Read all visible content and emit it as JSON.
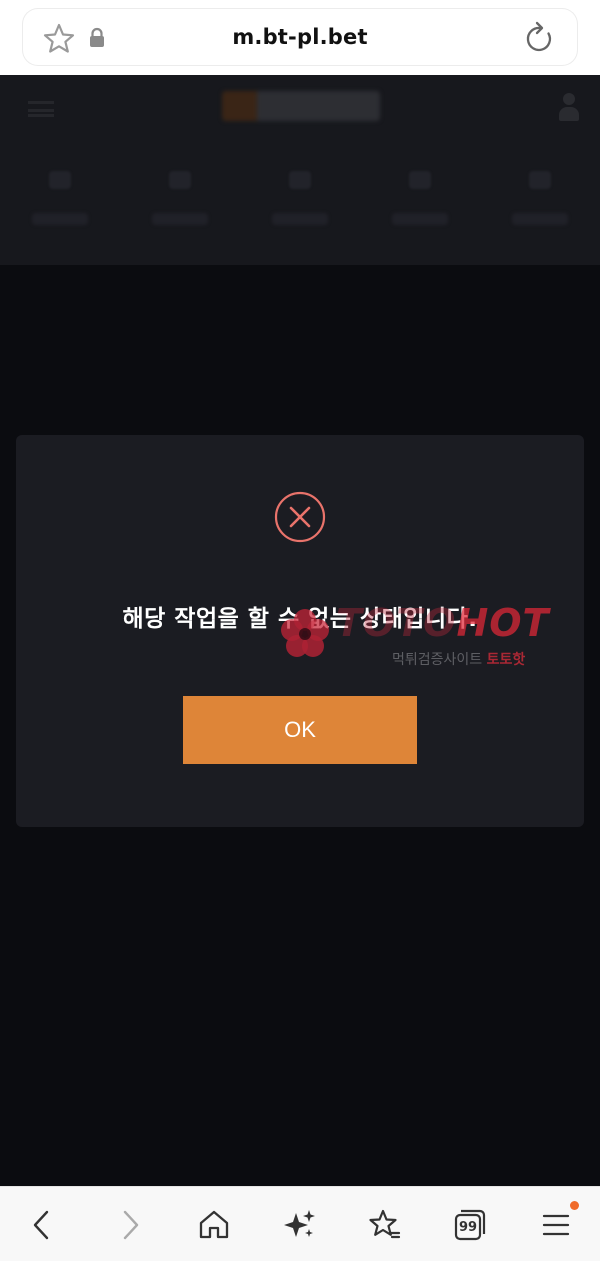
{
  "browser": {
    "url": "m.bt-pl.bet",
    "icons": [
      "star-icon",
      "lock-icon",
      "reload-icon"
    ]
  },
  "dialog": {
    "message": "해당 작업을 할 수 없는 상태입니다.",
    "ok_label": "OK",
    "icon": "error-x-icon",
    "colors": {
      "accent": "#de8538",
      "icon_ring": "#e9736b",
      "panel": "#1b1c22"
    }
  },
  "watermark": {
    "logo_part1": "TOTO",
    "logo_part2": "HOT",
    "sub_part1": "먹튀검증사이트 ",
    "sub_part2": "토토핫"
  },
  "bottom_bar": {
    "tabs_count": "99",
    "icons": [
      "back-icon",
      "forward-icon",
      "home-icon",
      "sparkle-icon",
      "bookmarks-icon",
      "tabs-icon",
      "menu-icon"
    ]
  }
}
